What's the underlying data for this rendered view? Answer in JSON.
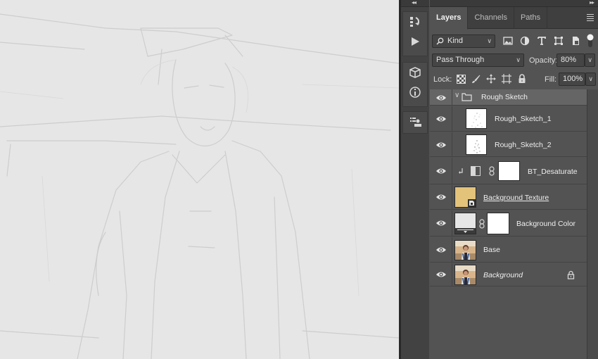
{
  "panel": {
    "tabs": [
      "Layers",
      "Channels",
      "Paths"
    ],
    "active_tab": "Layers",
    "filter": {
      "label": "Kind",
      "search_icon": "search-icon"
    },
    "blend_mode": "Pass Through",
    "opacity_label": "Opacity:",
    "opacity_value": "80%",
    "lock_label": "Lock:",
    "fill_label": "Fill:",
    "fill_value": "100%"
  },
  "layers": [
    {
      "name": "Rough Sketch",
      "kind": "group",
      "expanded": true
    },
    {
      "name": "Rough_Sketch_1",
      "kind": "pixel",
      "thumb": "sketch"
    },
    {
      "name": "Rough_Sketch_2",
      "kind": "pixel",
      "thumb": "sketch"
    },
    {
      "name": "BT_Desaturate",
      "kind": "adjustment",
      "clipped": true
    },
    {
      "name": "Background Texture",
      "kind": "smart-object",
      "thumb_color": "#e3c27a"
    },
    {
      "name": "Background Color",
      "kind": "fill"
    },
    {
      "name": "Base",
      "kind": "photo"
    },
    {
      "name": "Background",
      "kind": "photo",
      "locked": true,
      "italic": true
    }
  ],
  "colors": {
    "panel_bg": "#535353",
    "canvas_bg": "#e6e6e6",
    "group_row_bg": "#656565",
    "texture_thumb": "#e3c27a"
  },
  "mini_strip_icons": [
    "history-icon",
    "play-action-icon",
    "3d-icon",
    "info-icon",
    "properties-icon"
  ]
}
